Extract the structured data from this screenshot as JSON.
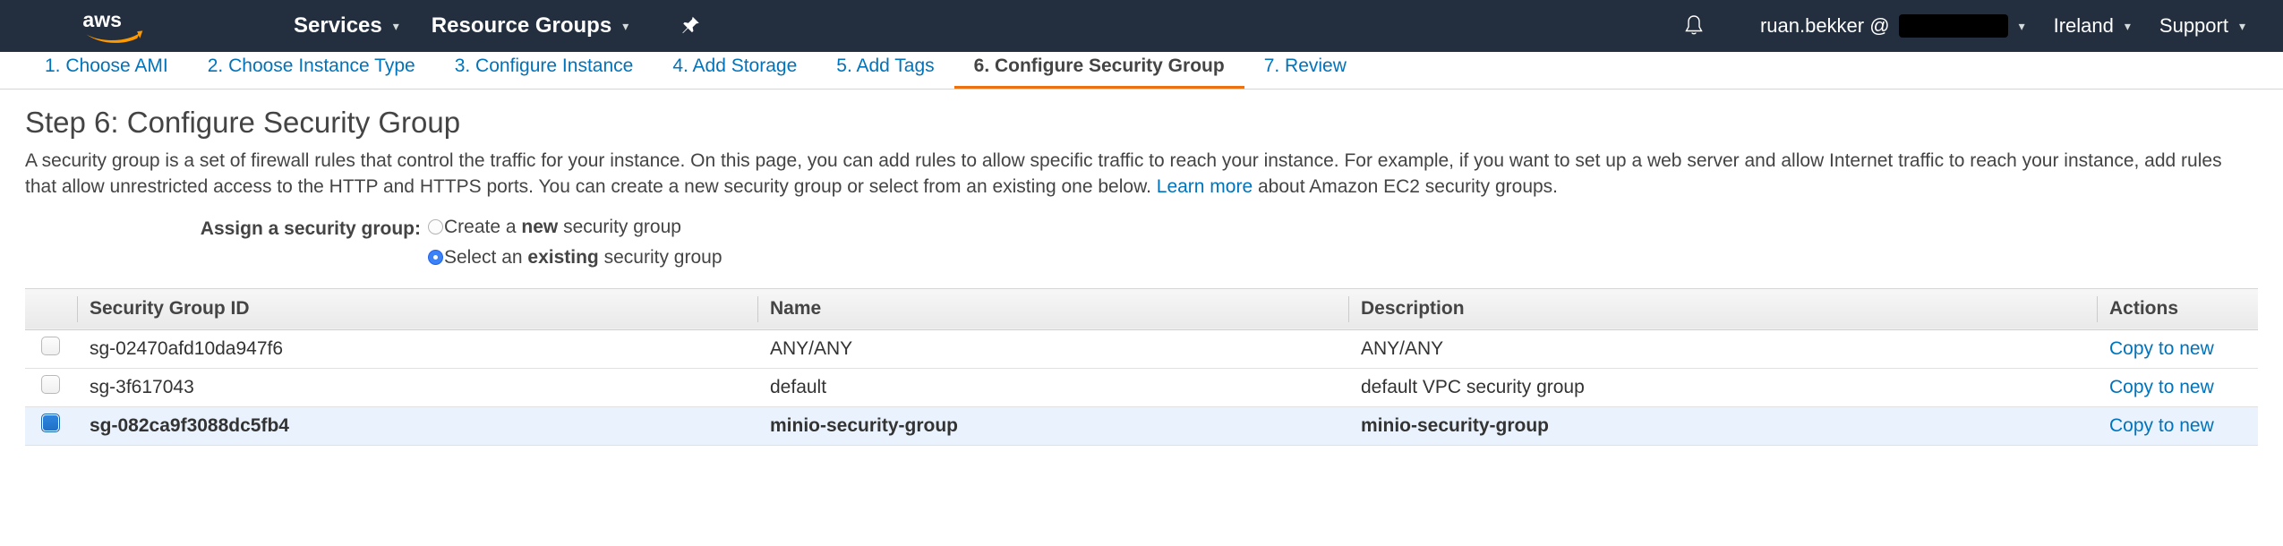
{
  "navbar": {
    "logo_alt": "aws",
    "items": [
      {
        "label": "Services",
        "caret": "▾"
      },
      {
        "label": "Resource Groups",
        "caret": "▾"
      }
    ],
    "pin_icon": "pin-icon",
    "bell_icon": "notifications-bell-icon",
    "account_name": "ruan.bekker @",
    "account_caret": "▾",
    "region": "Ireland",
    "region_caret": "▾",
    "support": "Support",
    "support_caret": "▾"
  },
  "steps": [
    {
      "label": "1. Choose AMI",
      "active": false
    },
    {
      "label": "2. Choose Instance Type",
      "active": false
    },
    {
      "label": "3. Configure Instance",
      "active": false
    },
    {
      "label": "4. Add Storage",
      "active": false
    },
    {
      "label": "5. Add Tags",
      "active": false
    },
    {
      "label": "6. Configure Security Group",
      "active": true
    },
    {
      "label": "7. Review",
      "active": false
    }
  ],
  "page": {
    "title": "Step 6: Configure Security Group",
    "description_part1": "A security group is a set of firewall rules that control the traffic for your instance. On this page, you can add rules to allow specific traffic to reach your instance. For example, if you want to set up a web server and allow Internet traffic to reach your instance, add rules that allow unrestricted access to the HTTP and HTTPS ports. You can create a new security group or select from an existing one below.",
    "learn_more": "Learn more",
    "description_part2": "about Amazon EC2 security groups."
  },
  "assign": {
    "label": "Assign a security group:",
    "options": [
      {
        "prefix": "Create a ",
        "bold": "new",
        "suffix": " security group",
        "selected": false
      },
      {
        "prefix": "Select an ",
        "bold": "existing",
        "suffix": " security group",
        "selected": true
      }
    ]
  },
  "table": {
    "columns": [
      "",
      "Security Group ID",
      "Name",
      "Description",
      "Actions"
    ],
    "action_label": "Copy to new",
    "rows": [
      {
        "checked": false,
        "id": "sg-02470afd10da947f6",
        "name": "ANY/ANY",
        "description": "ANY/ANY",
        "action": "Copy to new"
      },
      {
        "checked": false,
        "id": "sg-3f617043",
        "name": "default",
        "description": "default VPC security group",
        "action": "Copy to new"
      },
      {
        "checked": true,
        "id": "sg-082ca9f3088dc5fb4",
        "name": "minio-security-group",
        "description": "minio-security-group",
        "action": "Copy to new"
      }
    ]
  },
  "colors": {
    "nav_background": "#232f3e",
    "accent_orange": "#ec7211",
    "link_blue": "#0073bb",
    "selected_row": "#eaf3fd",
    "checkbox_blue": "#2f86e0"
  }
}
